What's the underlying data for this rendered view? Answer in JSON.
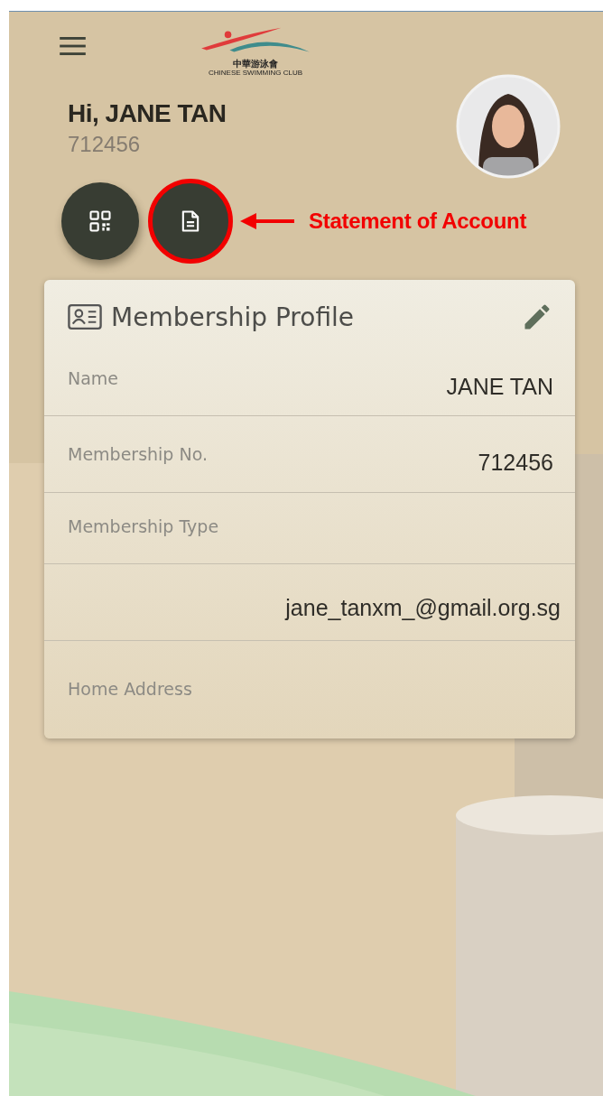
{
  "logo": {
    "chinese": "中華游泳會",
    "english": "CHINESE SWIMMING CLUB"
  },
  "greeting": "Hi, JANE TAN",
  "member_number": "712456",
  "actions": [
    {
      "kind": "qr",
      "highlighted": false
    },
    {
      "kind": "document",
      "highlighted": true
    }
  ],
  "annotation": {
    "label": "Statement of Account"
  },
  "profile": {
    "title": "Membership Profile",
    "rows": [
      {
        "label": "Name",
        "value": "JANE TAN"
      },
      {
        "label": "Membership No.",
        "value": "712456"
      },
      {
        "label": "Membership Type"
      },
      {
        "value": "jane_tanxm_@gmail.org.sg"
      },
      {
        "label": "Home Address"
      }
    ]
  }
}
